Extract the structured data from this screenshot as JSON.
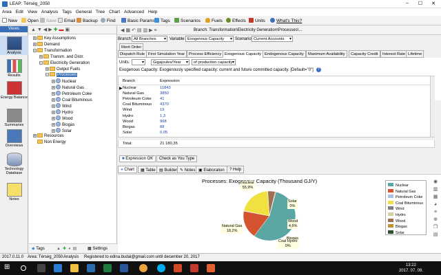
{
  "window": {
    "title": "LEAP: Térség_2050",
    "min": "–",
    "max": "☐",
    "close": "✕"
  },
  "menu": [
    "Area",
    "Edit",
    "View",
    "Analysis",
    "Tags",
    "General",
    "Tree",
    "Chart",
    "Advanced",
    "Help"
  ],
  "toolbar": {
    "new": "New",
    "open": "Open",
    "save": "Save",
    "email": "Email",
    "backup": "Backup",
    "find": "Find",
    "basic_params": "Basic Params",
    "tags": "Tags",
    "scenarios": "Scenarios",
    "fuels": "Fuels",
    "effects": "Effects",
    "units": "Units",
    "whats_this": "What's This?"
  },
  "views": {
    "header": "Views",
    "items": [
      "Analysis",
      "Results",
      "Energy Balance",
      "Summaries",
      "Overviews",
      "Technology Database",
      "Notes"
    ]
  },
  "tree": {
    "nodes": [
      {
        "label": "Key Assumptions",
        "level": 0,
        "type": "folder",
        "expand": "+"
      },
      {
        "label": "Demand",
        "level": 0,
        "type": "folder",
        "expand": "+"
      },
      {
        "label": "Transformation",
        "level": 0,
        "type": "folder",
        "expand": "−"
      },
      {
        "label": "Transm. and Distr.",
        "level": 1,
        "type": "folder",
        "expand": "+"
      },
      {
        "label": "Electricity Generation",
        "level": 1,
        "type": "folder",
        "expand": "−"
      },
      {
        "label": "Output Fuels",
        "level": 2,
        "type": "folder",
        "expand": "+"
      },
      {
        "label": "Processes",
        "level": 2,
        "type": "folder",
        "expand": "−",
        "selected": true
      },
      {
        "label": "Nuclear",
        "level": 3,
        "type": "leaf",
        "expand": "+"
      },
      {
        "label": "Natural Gas",
        "level": 3,
        "type": "leaf",
        "expand": "+"
      },
      {
        "label": "Petroleum Coke",
        "level": 3,
        "type": "leaf",
        "expand": "+"
      },
      {
        "label": "Coal Bituminous",
        "level": 3,
        "type": "leaf",
        "expand": "+"
      },
      {
        "label": "Wind",
        "level": 3,
        "type": "leaf",
        "expand": "+"
      },
      {
        "label": "Hydro",
        "level": 3,
        "type": "leaf",
        "expand": "+"
      },
      {
        "label": "Wood",
        "level": 3,
        "type": "leaf",
        "expand": "+"
      },
      {
        "label": "Biogas",
        "level": 3,
        "type": "leaf",
        "expand": "+"
      },
      {
        "label": "Solar",
        "level": 3,
        "type": "leaf",
        "expand": "+"
      },
      {
        "label": "Resources",
        "level": 0,
        "type": "folder",
        "expand": "+"
      },
      {
        "label": "Non Energy",
        "level": 0,
        "type": "folder",
        "expand": ""
      }
    ],
    "bottom_tags": "Tags",
    "bottom_settings": "Settings"
  },
  "breadcrumb": "Branch: Transformation\\Electricity Generation\\Processes\\...",
  "selectors": {
    "branch_label": "Branch",
    "branch_value": "All Branches",
    "variable_label": "Variable",
    "variable_value": "Exogenous Capacity",
    "scenario_label": "Scenario",
    "scenario_value": "Current Accounts"
  },
  "tabs_row1": [
    "Merit Order"
  ],
  "tabs_row2": [
    "Dispatch Rule",
    "First Simulation Year",
    "Process Efficiency",
    "Exogenous Capacity",
    "Endogenous Capacity",
    "Maximum Availability",
    "Capacity Credit",
    "Interest Rate",
    "Lifetime"
  ],
  "active_tab": "Exogenous Capacity",
  "units": {
    "label": "Units:",
    "unit": "Gigajoules/Year",
    "per": "of production capacity"
  },
  "description": "Exogenous Capacity: Exogenously specified capacity: current and future committed capacity. [Default=\"0\"]",
  "grid": {
    "headers": [
      "Branch",
      "Expression"
    ],
    "rows": [
      [
        "Nuclear",
        "11843"
      ],
      [
        "Natural Gas",
        "3850"
      ],
      [
        "Petroleum Coke",
        "41"
      ],
      [
        "Coal Bituminous",
        "4370"
      ],
      [
        "Wind",
        "19"
      ],
      [
        "Hydro",
        "1,3"
      ],
      [
        "Wood",
        "968"
      ],
      [
        "Biogas",
        "88"
      ],
      [
        "Solar",
        "0,05"
      ]
    ],
    "total_label": "Total:",
    "total_value": "21 180,35"
  },
  "expression_ok": "Expression OK",
  "check_as_type": "Check as You Type",
  "bottom_tabs": [
    "Chart",
    "Table",
    "Builder",
    "Notes",
    "Elaboration",
    "Help"
  ],
  "chart_data": {
    "type": "pie",
    "title": "Processes: Exogenous Capacity (Thousand GJ/Y)",
    "categories": [
      "Nuclear",
      "Natural Gas",
      "Petroleum Coke",
      "Coal Bituminous",
      "Wind",
      "Hydro",
      "Wood",
      "Biogas",
      "Solar"
    ],
    "values": [
      55.9,
      18.2,
      0.2,
      20.6,
      0.1,
      0.0,
      4.6,
      0.4,
      0.0
    ],
    "labels": [
      {
        "name": "Nuclear",
        "pct": "55,9%"
      },
      {
        "name": "Natural Gas",
        "pct": "18,2%"
      },
      {
        "name": "Solar",
        "pct": "0%"
      },
      {
        "name": "Wood",
        "pct": "4,6%"
      },
      {
        "name": "Biogas",
        "pct": "0,4%"
      },
      {
        "name": "Coal Hydro",
        "pct": "0%"
      }
    ],
    "colors": [
      "#5aa6a3",
      "#d5532f",
      "#a6c3e0",
      "#f0e040",
      "#7f7f7f",
      "#d4d0a0",
      "#a07050",
      "#c09030",
      "#305030"
    ],
    "legend_position": "right"
  },
  "status": {
    "version": "2017.0.11.0",
    "area": "Area: Térség_2050",
    "mode": "Analysis",
    "registered": "Registered to edina.budai@gmail.com until december 20, 2017"
  },
  "clock": {
    "time": "13:22",
    "date": "2017. 07. 09."
  }
}
